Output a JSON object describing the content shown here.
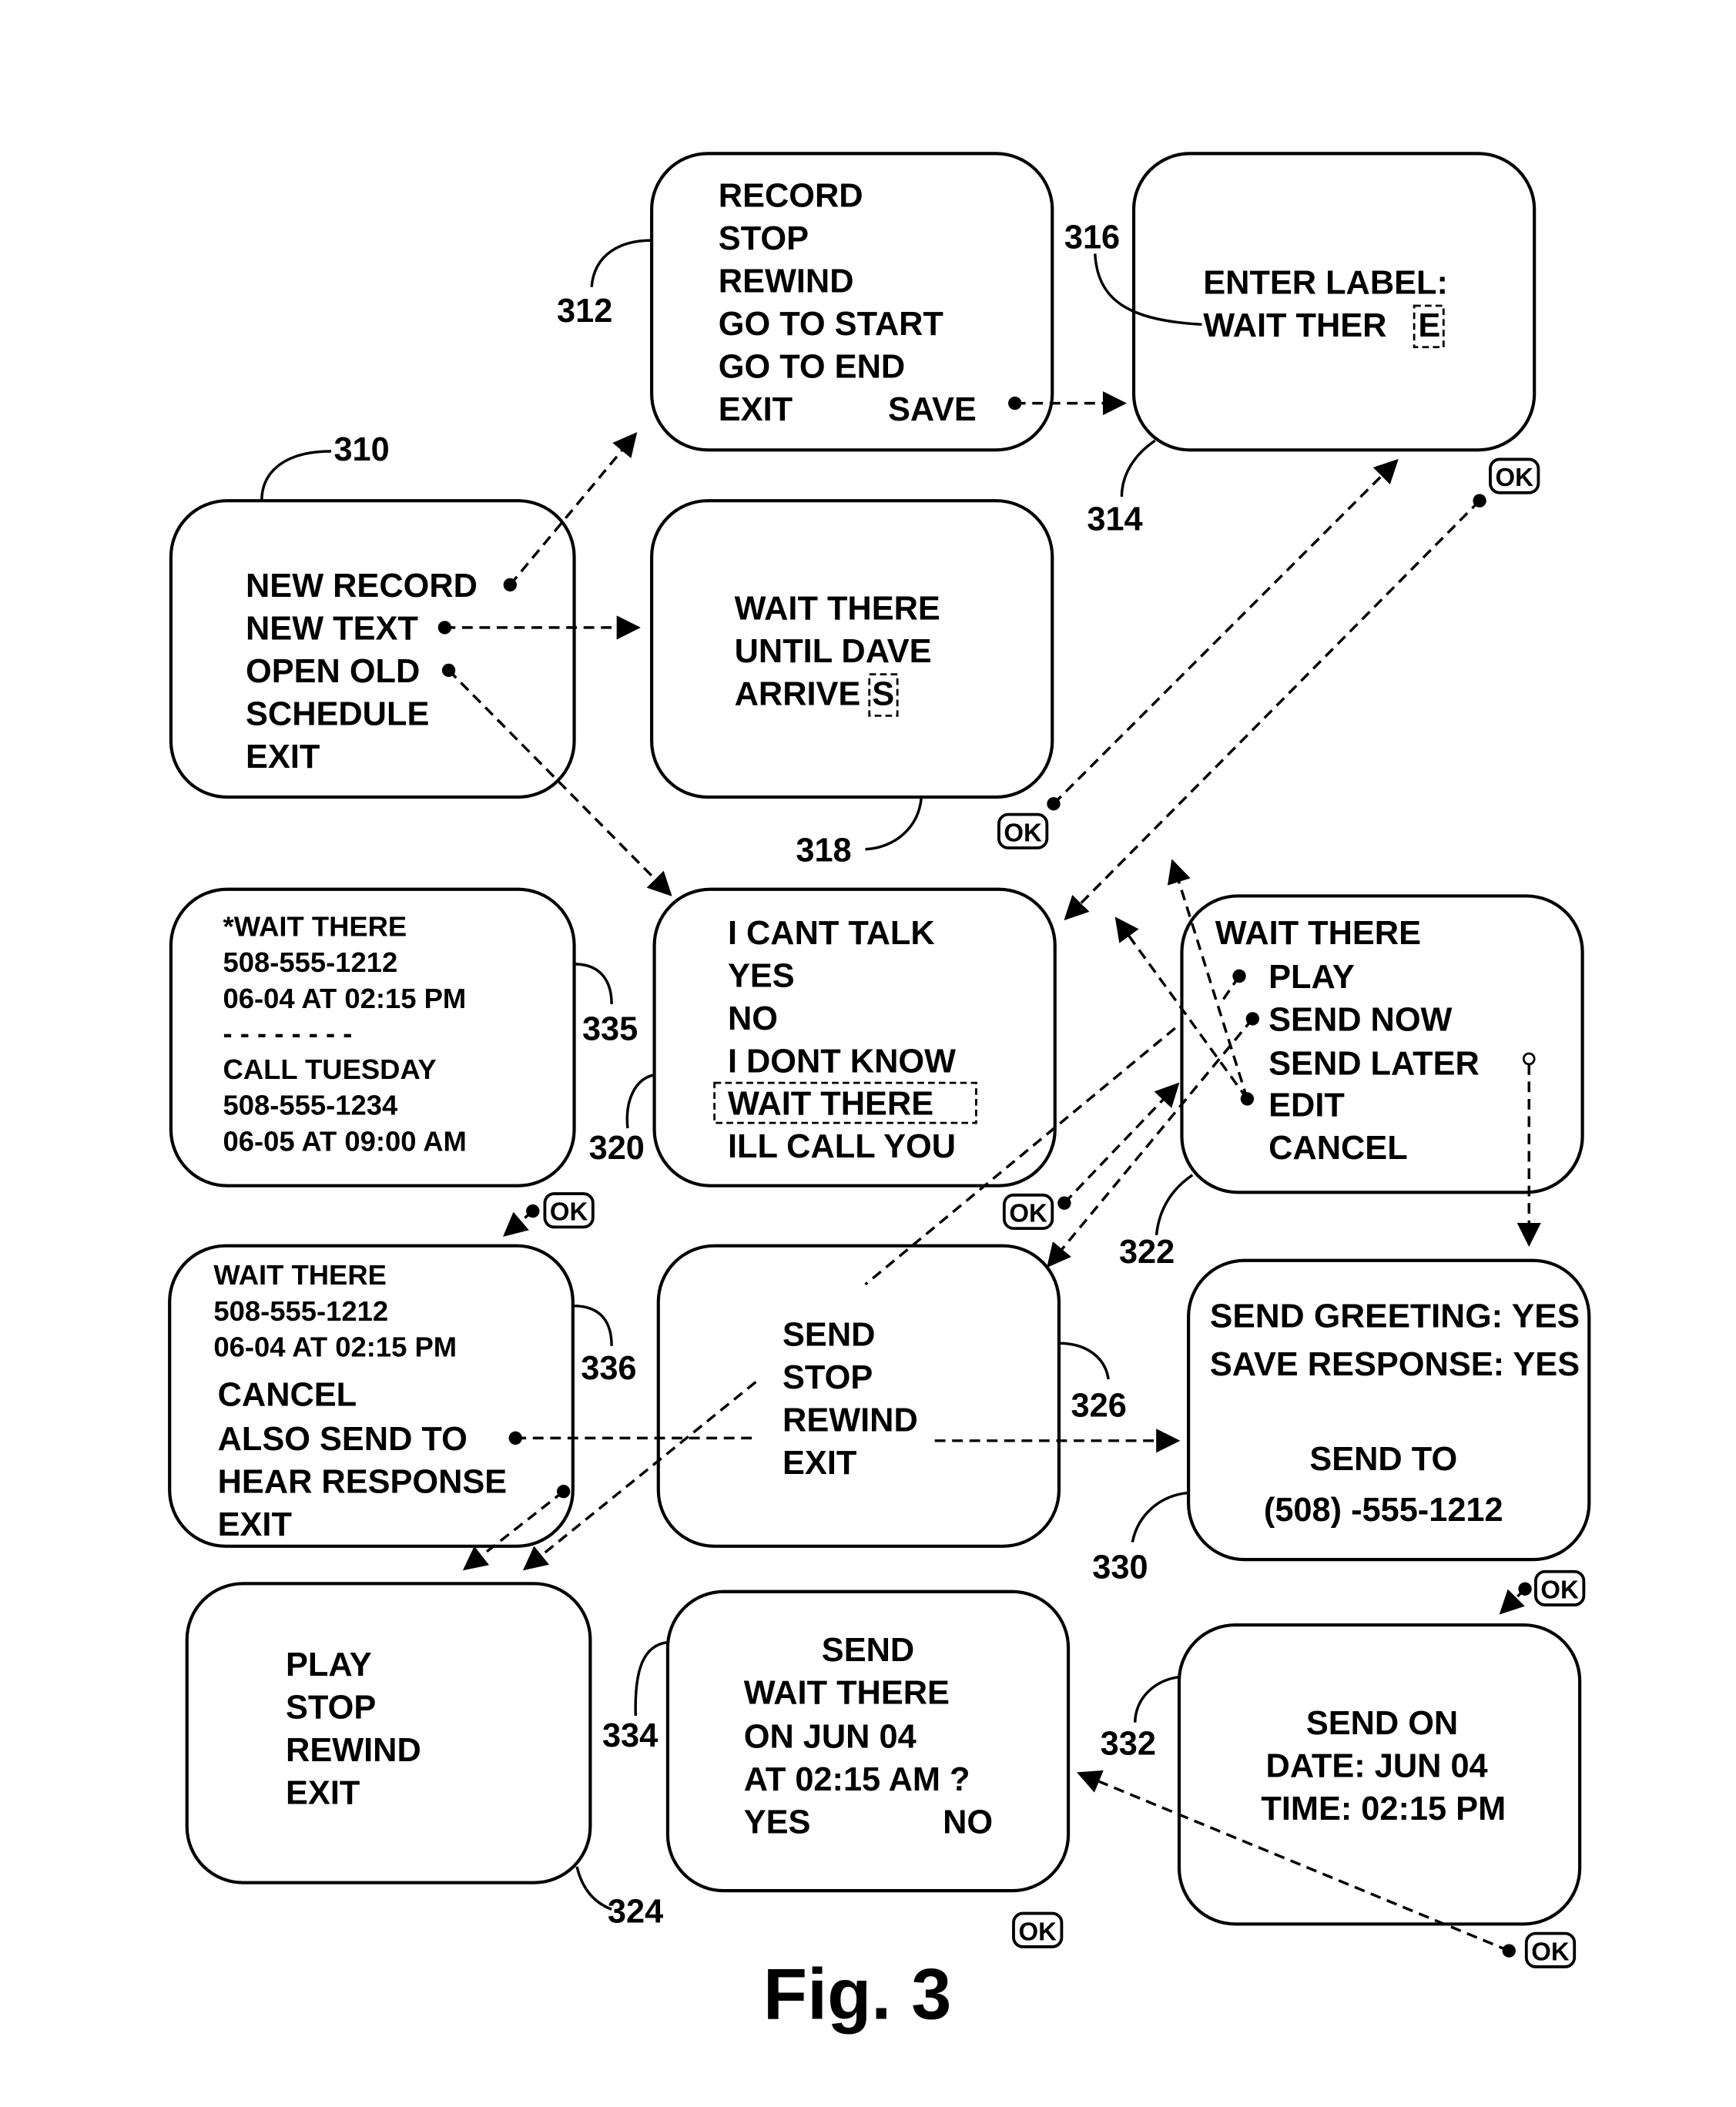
{
  "figure": {
    "caption": "Fig. 3",
    "ok_label": "OK"
  },
  "screens": {
    "s310": {
      "ref": "310",
      "lines": [
        "NEW RECORD",
        "NEW TEXT",
        "OPEN OLD",
        "SCHEDULE",
        "EXIT"
      ]
    },
    "s312": {
      "ref": "312",
      "lines": [
        "RECORD",
        "STOP",
        "REWIND",
        "GO TO START",
        "GO TO END",
        "EXIT"
      ],
      "save": "SAVE"
    },
    "s314": {
      "ref": "314",
      "label_ref": "316",
      "lines": [
        "ENTER LABEL:",
        "WAIT  THER"
      ],
      "cursor_char": "E"
    },
    "s318": {
      "ref": "318",
      "lines": [
        "WAIT THERE",
        "UNTIL DAVE",
        "ARRIVE"
      ],
      "cursor_char": "S"
    },
    "s320": {
      "ref": "320",
      "lines": [
        "I CANT TALK",
        "YES",
        "NO",
        "I DONT KNOW",
        "WAIT THERE",
        "ILL CALL YOU"
      ],
      "selected_index": 4
    },
    "s322": {
      "ref": "322",
      "title": "WAIT THERE",
      "lines": [
        "PLAY",
        "SEND NOW",
        "SEND LATER",
        "EDIT",
        "CANCEL"
      ]
    },
    "s335": {
      "ref": "335",
      "lines": [
        "*WAIT THERE",
        "508-555-1212",
        "06-04 AT 02:15 PM",
        "- - - - - - - -",
        "CALL TUESDAY",
        "508-555-1234",
        "06-05 AT 09:00 AM"
      ]
    },
    "s336": {
      "ref": "336",
      "info": [
        "WAIT THERE",
        "508-555-1212",
        "06-04 AT 02:15 PM"
      ],
      "lines": [
        "CANCEL",
        "ALSO SEND TO",
        "HEAR RESPONSE",
        "EXIT"
      ]
    },
    "s326": {
      "ref": "326",
      "lines": [
        "SEND",
        "STOP",
        "REWIND",
        "EXIT"
      ]
    },
    "s330": {
      "ref": "330",
      "lines": [
        "SEND GREETING:  YES",
        "SAVE RESPONSE: YES",
        "SEND TO",
        "(508) -555-1212"
      ]
    },
    "s324": {
      "ref": "324",
      "lines": [
        "PLAY",
        "STOP",
        "REWIND",
        "EXIT"
      ]
    },
    "s334": {
      "ref": "334",
      "lines": [
        "SEND",
        "WAIT THERE",
        "ON JUN 04",
        "AT 02:15 AM ?"
      ],
      "yes": "YES",
      "no": "NO"
    },
    "s332": {
      "ref": "332",
      "lines": [
        "SEND ON",
        "DATE:  JUN  04",
        "TIME:  02:15 PM"
      ]
    }
  }
}
